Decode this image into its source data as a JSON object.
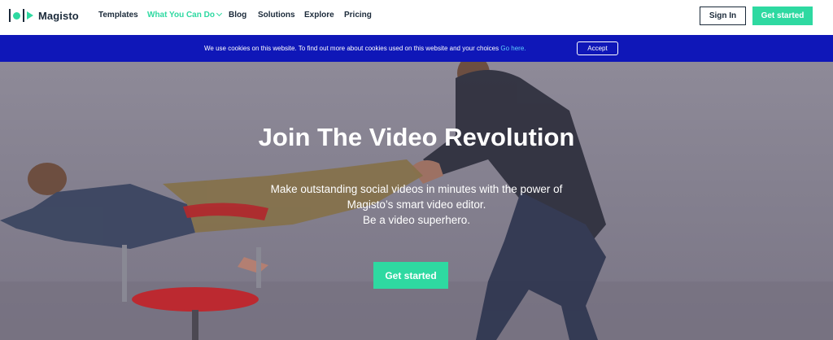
{
  "brand": {
    "name": "Magisto",
    "accent_color": "#2ed9a1",
    "dark_color": "#1b2a3a"
  },
  "nav": {
    "items": [
      {
        "label": "Templates"
      },
      {
        "label": "What You Can Do",
        "active": true,
        "icon": "chevron-down-icon"
      },
      {
        "label": "Blog"
      },
      {
        "label": "Solutions"
      },
      {
        "label": "Explore"
      },
      {
        "label": "Pricing"
      }
    ]
  },
  "header": {
    "signin_label": "Sign In",
    "get_started_label": "Get started"
  },
  "cookie": {
    "background_color": "#0f17b8",
    "text": "We use cookies on this website. To find out more about cookies used on this website and your choices ",
    "link_label": "Go here.",
    "accept_label": "Accept"
  },
  "hero": {
    "title": "Join The Video Revolution",
    "subtitle_lines": [
      "Make outstanding social videos in minutes with the power of",
      "Magisto’s smart video editor.",
      "Be a video superhero."
    ],
    "cta_label": "Get started"
  }
}
